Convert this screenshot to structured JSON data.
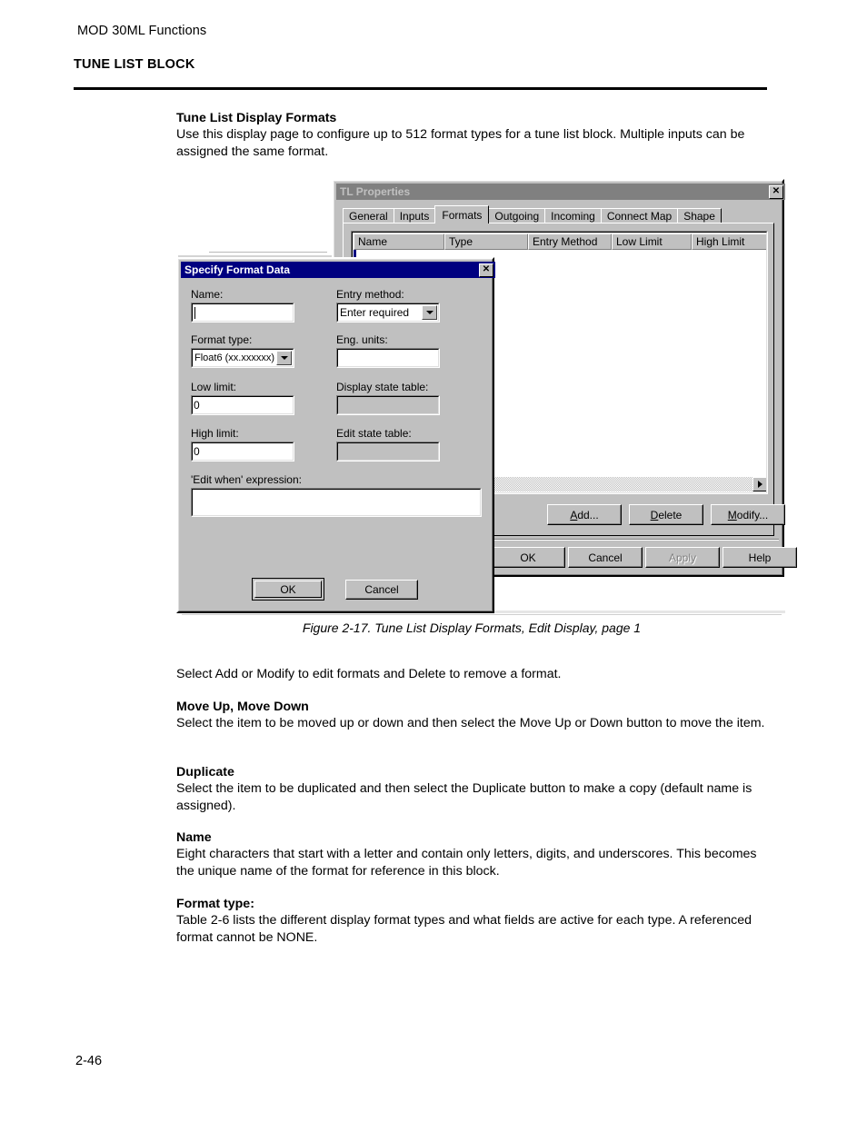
{
  "page": {
    "running_header": "MOD 30ML Functions",
    "chapter_title": "TUNE LIST BLOCK",
    "page_number": "2-46"
  },
  "content": {
    "intro": {
      "heading": "Tune List Display Formats",
      "body": "Use this display page to configure up to 512 format types for a tune list block. Multiple inputs can be assigned the same format."
    },
    "figure_caption": "Figure 2-17.  Tune List Display Formats, Edit Display, page 1",
    "after_figure": "Select Add or Modify to edit formats and Delete to remove a format.",
    "sections": [
      {
        "heading": "Move Up, Move Down",
        "body": "Select the item to be moved up or down and then select the Move Up or Down button to move the item."
      },
      {
        "heading": "Duplicate",
        "body": "Select the item to be duplicated and then select the Duplicate button to make a copy (default name is assigned)."
      },
      {
        "heading": "Name",
        "body": "Eight characters that start with a letter and contain only letters, digits, and underscores. This becomes the unique name of the format for reference in this block."
      },
      {
        "heading": "Format type:",
        "body": "Table 2-6 lists the different display format types and what fields are active for each type. A referenced format cannot be NONE."
      }
    ]
  },
  "tl_properties": {
    "title": "TL Properties",
    "close_label": "✕",
    "state": "inactive",
    "tabs": [
      {
        "label": "General",
        "active": false
      },
      {
        "label": "Inputs",
        "active": false
      },
      {
        "label": "Formats",
        "active": true
      },
      {
        "label": "Outgoing",
        "active": false
      },
      {
        "label": "Incoming",
        "active": false
      },
      {
        "label": "Connect Map",
        "active": false
      },
      {
        "label": "Shape",
        "active": false
      }
    ],
    "list": {
      "columns": [
        "Name",
        "Type",
        "Entry Method",
        "Low Limit",
        "High Limit"
      ],
      "rows": []
    },
    "item_buttons": [
      {
        "label": "Add...",
        "accel": "A",
        "disabled": false
      },
      {
        "label": "Delete",
        "accel": "D",
        "disabled": false
      },
      {
        "label": "Modify...",
        "accel": "M",
        "disabled": false
      }
    ],
    "dialog_buttons": [
      {
        "label": "OK",
        "disabled": false
      },
      {
        "label": "Cancel",
        "disabled": false
      },
      {
        "label": "Apply",
        "disabled": true
      },
      {
        "label": "Help",
        "disabled": false
      }
    ]
  },
  "specify_format_data": {
    "title": "Specify Format Data",
    "close_label": "✕",
    "state": "active",
    "fields": {
      "name": {
        "label": "Name:",
        "value": "",
        "type": "text",
        "disabled": false
      },
      "entry_method": {
        "label": "Entry method:",
        "value": "Enter required",
        "type": "combo",
        "disabled": false
      },
      "format_type": {
        "label": "Format type:",
        "value": "Float6 (xx.xxxxxx)",
        "type": "combo",
        "disabled": false
      },
      "eng_units": {
        "label": "Eng. units:",
        "value": "",
        "type": "text",
        "disabled": false
      },
      "low_limit": {
        "label": "Low limit:",
        "value": "0",
        "type": "text",
        "disabled": false
      },
      "display_state_table": {
        "label": "Display state table:",
        "value": "",
        "type": "text",
        "disabled": true
      },
      "high_limit": {
        "label": "High limit:",
        "value": "0",
        "type": "text",
        "disabled": false
      },
      "edit_state_table": {
        "label": "Edit state table:",
        "value": "",
        "type": "text",
        "disabled": true
      },
      "edit_when_expression": {
        "label": "'Edit when' expression:",
        "value": "",
        "type": "text",
        "disabled": false
      }
    },
    "buttons": [
      {
        "label": "OK",
        "default": true
      },
      {
        "label": "Cancel",
        "default": false
      }
    ]
  },
  "colors": {
    "active_titlebar": "#000080",
    "inactive_titlebar": "#808080",
    "dialog_face": "#c0c0c0",
    "field_white": "#ffffff",
    "disabled_text": "#808080"
  }
}
